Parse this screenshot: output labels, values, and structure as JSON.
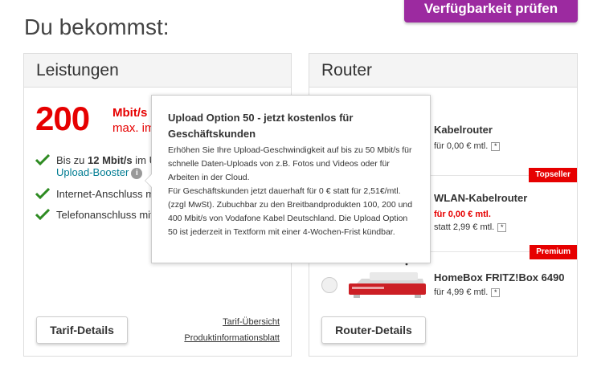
{
  "cta": {
    "label": "Verfügbarkeit prüfen"
  },
  "page_title": "Du bekommst:",
  "leistungen": {
    "title": "Leistungen",
    "speed_value": "200",
    "speed_unit": "Mbit/s",
    "speed_sub": "max. im D",
    "features": [
      {
        "text_pre": "Bis zu ",
        "text_bold": "12 Mbit/s",
        "text_post": " im U",
        "link": "Upload-Booster",
        "info": "i"
      },
      {
        "text": "Internet-Anschluss m"
      },
      {
        "text": "Telefonanschluss mit"
      }
    ],
    "button": "Tarif-Details",
    "link_tarif": "Tarif-Übersicht",
    "link_product": "Produktinformationsblatt"
  },
  "router": {
    "title": "Router",
    "options": [
      {
        "name": "Kabelrouter",
        "price": "für 0,00 € mtl.",
        "star": "*"
      },
      {
        "name": "WLAN-Kabelrouter",
        "price_red": "für 0,00 € mtl.",
        "price_old": "statt 2,99 € mtl.",
        "star": "*",
        "badge": "Topseller"
      },
      {
        "name": "HomeBox FRITZ!Box 6490",
        "price": "für 4,99 € mtl.",
        "star": "*",
        "badge": "Premium"
      }
    ],
    "button": "Router-Details"
  },
  "tooltip": {
    "title": "Upload Option 50 - jetzt kostenlos für Geschäftskunden",
    "body": "Erhöhen Sie Ihre Upload-Geschwindigkeit auf bis zu 50 Mbit/s für schnelle Daten-Uploads von z.B. Fotos und Videos oder für Arbeiten in der Cloud.\nFür Geschäftskunden jetzt dauerhaft für 0 € statt für 2,51€/mtl. (zzgl MwSt). Zubuchbar zu den Breitbandprodukten 100, 200 und 400 Mbit/s von Vodafone Kabel Deutschland. Die Upload Option 50 ist jederzeit in Textform mit einer 4-Wochen-Frist kündbar."
  },
  "colors": {
    "brand_red": "#e60000",
    "cta_purple": "#9c2aa0",
    "link_teal": "#007c92"
  }
}
